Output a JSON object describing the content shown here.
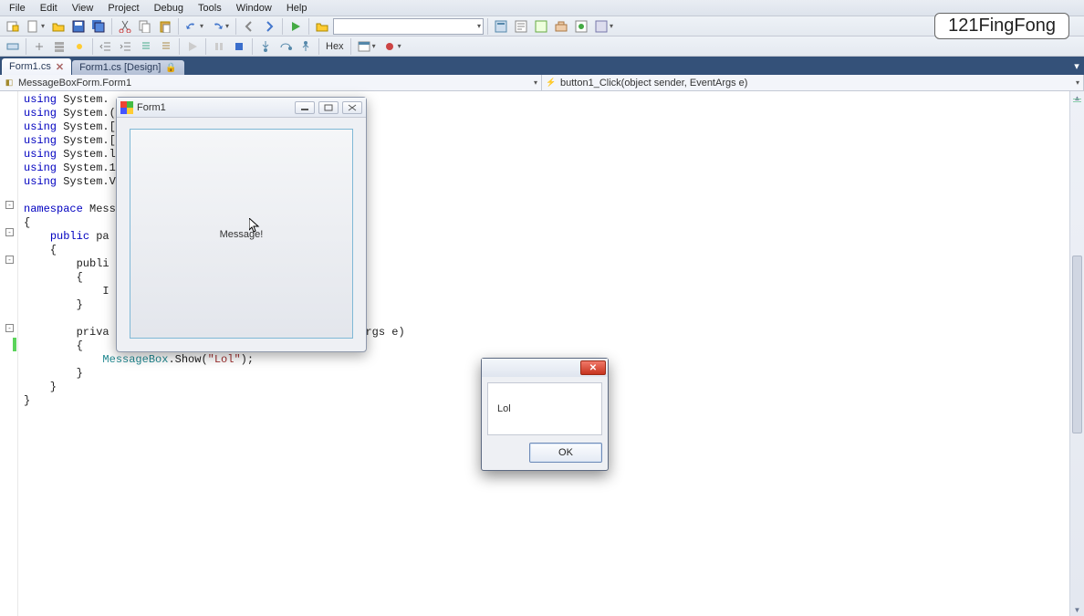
{
  "menubar": {
    "items": [
      "File",
      "Edit",
      "View",
      "Project",
      "Debug",
      "Tools",
      "Window",
      "Help"
    ]
  },
  "toolbar": {
    "hex_label": "Hex"
  },
  "watermark": "121FingFong",
  "tabs": {
    "active": {
      "label": "Form1.cs"
    },
    "inactive": {
      "label": "Form1.cs [Design]"
    }
  },
  "nav": {
    "left": "MessageBoxForm.Form1",
    "right": "button1_Click(object sender, EventArgs e)"
  },
  "code": {
    "lines": [
      "using System.",
      "using System.(",
      "using System.[",
      "using System.[",
      "using System.l",
      "using System.1",
      "using System.V",
      "",
      "namespace Mess",
      "{",
      "    public pa",
      "    {",
      "        publi",
      "        {",
      "            I",
      "        }",
      "",
      "        priva",
      "        {",
      "            MessageBox.Show(\"Lol\");",
      "        }",
      "    }",
      "}"
    ],
    "trailing_visible": "rgs e)"
  },
  "form1": {
    "title": "Form1",
    "button_label": "Message!"
  },
  "msgbox": {
    "text": "Lol",
    "ok_label": "OK"
  }
}
